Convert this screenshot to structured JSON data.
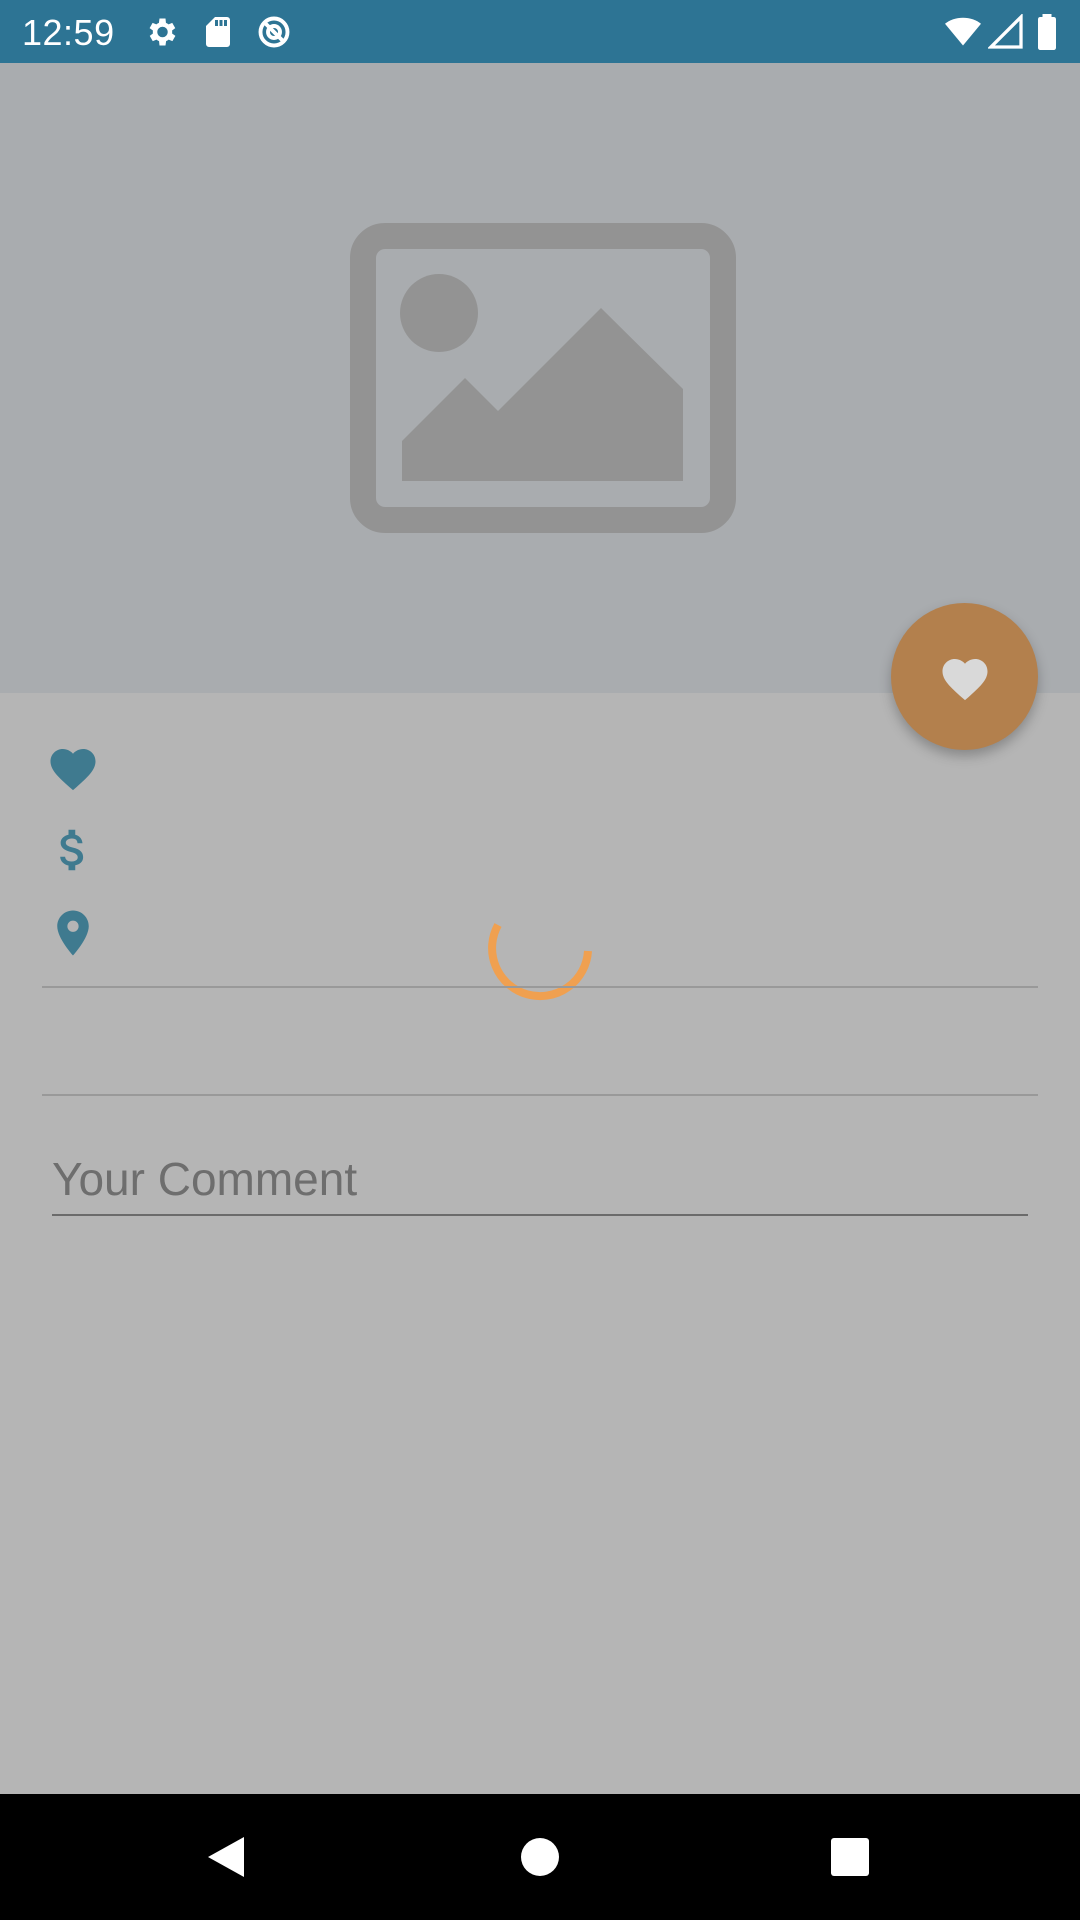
{
  "status_bar": {
    "time": "12:59",
    "left_icons": [
      "gear-icon",
      "sd-card-icon",
      "data-saver-icon"
    ],
    "right_icons": [
      "wifi-icon",
      "cell-signal-icon",
      "battery-icon"
    ],
    "background": "#2d7494"
  },
  "hero": {
    "image_icon": "image-placeholder-icon",
    "background": "#a9acaf"
  },
  "fab": {
    "icon": "heart-icon",
    "color": "#b3804d"
  },
  "details": {
    "icons": [
      "heart-icon",
      "dollar-icon",
      "location-pin-icon"
    ],
    "icon_color": "#3f7a8f"
  },
  "loading": {
    "spinner_color": "#f0a050"
  },
  "comment": {
    "placeholder": "Your Comment",
    "value": ""
  },
  "nav_bar": {
    "buttons": [
      "back-icon",
      "home-icon",
      "recents-icon"
    ]
  }
}
